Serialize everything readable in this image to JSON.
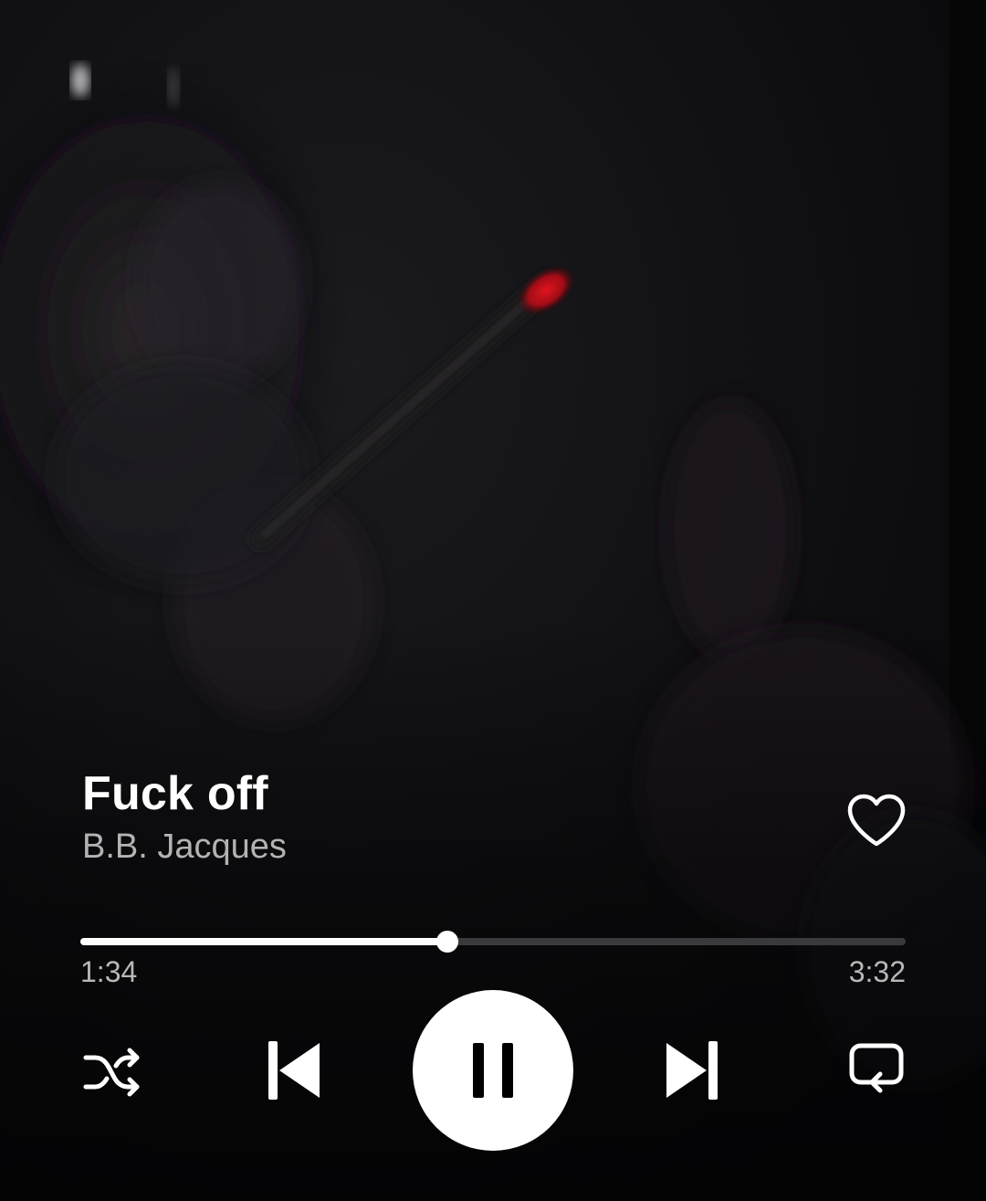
{
  "track": {
    "title": "Fuck off",
    "artist": "B.B. Jacques",
    "liked": false
  },
  "playback": {
    "elapsed": "1:34",
    "duration": "3:32",
    "progress_fraction": 0.445,
    "state": "playing"
  },
  "controls": {
    "shuffle_icon": "shuffle-icon",
    "previous_icon": "skip-previous-icon",
    "pause_icon": "pause-icon",
    "next_icon": "skip-next-icon",
    "repeat_icon": "repeat-icon",
    "like_icon": "heart-outline-icon"
  },
  "colors": {
    "background": "#0b0a0c",
    "primary_text": "#ffffff",
    "secondary_text": "#b3b3b3",
    "progress_fill": "#ffffff",
    "progress_track": "#3a393c",
    "ember": "#d0121e"
  }
}
